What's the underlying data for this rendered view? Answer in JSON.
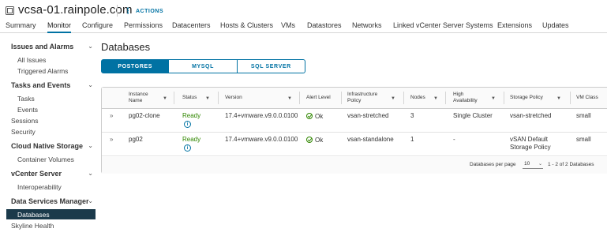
{
  "header": {
    "title": "vcsa-01.rainpole.com",
    "actions_label": "ACTIONS",
    "actions_icon": "vertical-dots-icon"
  },
  "tabs": [
    {
      "label": "Summary",
      "active": false
    },
    {
      "label": "Monitor",
      "active": true
    },
    {
      "label": "Configure",
      "active": false
    },
    {
      "label": "Permissions",
      "active": false
    },
    {
      "label": "Datacenters",
      "active": false
    },
    {
      "label": "Hosts & Clusters",
      "active": false
    },
    {
      "label": "VMs",
      "active": false
    },
    {
      "label": "Datastores",
      "active": false
    },
    {
      "label": "Networks",
      "active": false
    },
    {
      "label": "Linked vCenter Server Systems",
      "active": false
    },
    {
      "label": "Extensions",
      "active": false
    },
    {
      "label": "Updates",
      "active": false
    }
  ],
  "sidebar": {
    "issues_group": "Issues and Alarms",
    "issues_items": [
      "All Issues",
      "Triggered Alarms"
    ],
    "tasks_group": "Tasks and Events",
    "tasks_items": [
      "Tasks",
      "Events"
    ],
    "sessions": "Sessions",
    "security": "Security",
    "cns_group": "Cloud Native Storage",
    "cns_items": [
      "Container Volumes"
    ],
    "vcs_group": "vCenter Server",
    "vcs_items": [
      "Interoperability"
    ],
    "dsm_group": "Data Services Manager",
    "dsm_selected": "Databases",
    "skyline": "Skyline Health"
  },
  "main": {
    "title": "Databases",
    "segments": [
      {
        "label": "POSTGRES",
        "active": true
      },
      {
        "label": "MYSQL",
        "active": false
      },
      {
        "label": "SQL SERVER",
        "active": false
      }
    ]
  },
  "grid": {
    "columns": [
      "Instance Name",
      "Status",
      "Version",
      "Alert Level",
      "Infrastructure Policy",
      "Nodes",
      "High Availability",
      "Storage Policy",
      "VM Class"
    ],
    "rows": [
      {
        "instance": "pg02-clone",
        "status": "Ready",
        "version": "17.4+vmware.v9.0.0.0100",
        "alert": "Ok",
        "infra_policy": "vsan-stretched",
        "nodes": "3",
        "ha": "Single Cluster",
        "storage_policy": "vsan-stretched",
        "vm_class": "small"
      },
      {
        "instance": "pg02",
        "status": "Ready",
        "version": "17.4+vmware.v9.0.0.0100",
        "alert": "Ok",
        "infra_policy": "vsan-standalone",
        "nodes": "1",
        "ha": "-",
        "storage_policy": "vSAN Default Storage Policy",
        "vm_class": "small"
      }
    ],
    "footer": {
      "per_page_label": "Databases per page",
      "per_page_value": "10",
      "range_label": "1 - 2 of 2 Databases"
    }
  },
  "colors": {
    "accent": "#0072a3",
    "ready": "#318700",
    "sidebar_selected": "#1b3a4b"
  }
}
